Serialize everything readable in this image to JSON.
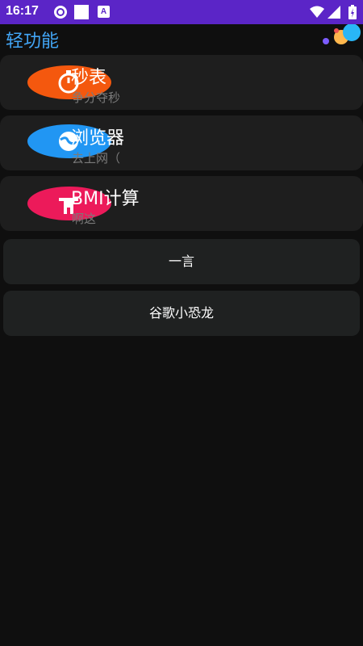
{
  "status_bar": {
    "time": "16:17",
    "notif_a_label": "A"
  },
  "app_bar": {
    "title": "轻功能"
  },
  "features": [
    {
      "title": "秒表",
      "subtitle": "争分夺秒",
      "color": "#f4580e",
      "icon": "stopwatch-icon"
    },
    {
      "title": "浏览器",
      "subtitle": "去上网（",
      "color": "#2196f3",
      "icon": "browser-icon"
    },
    {
      "title": "BMI计算",
      "subtitle": "啊这",
      "color": "#ec1a5a",
      "icon": "scale-icon"
    }
  ],
  "buttons": [
    {
      "label": "一言"
    },
    {
      "label": "谷歌小恐龙"
    }
  ],
  "colors": {
    "status_bar": "#5b25c7",
    "accent": "#42a5f5",
    "background": "#0f0f0f",
    "card": "#1e1e1e"
  }
}
